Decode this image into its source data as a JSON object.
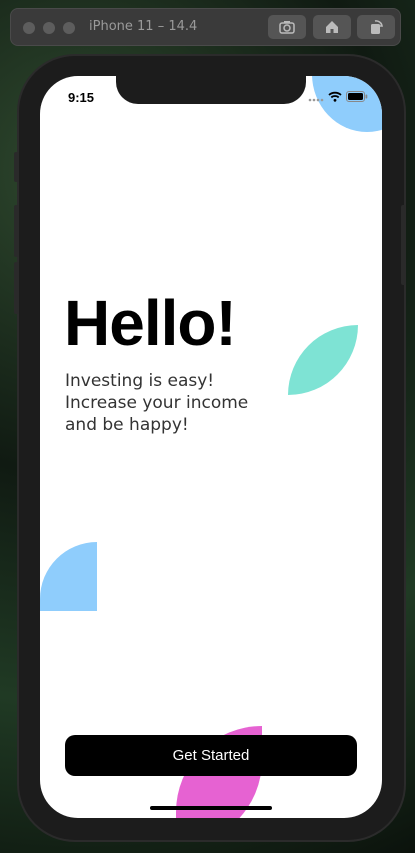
{
  "window": {
    "title": "iPhone 11 – 14.4",
    "buttons": [
      "screenshot-icon",
      "home-icon",
      "rotate-icon"
    ]
  },
  "status_bar": {
    "time": "9:15",
    "icons": [
      "signal-icon",
      "wifi-icon",
      "battery-icon"
    ]
  },
  "content": {
    "heading": "Hello!",
    "tagline_lines": [
      "Investing is easy!",
      "Increase your income",
      "and be happy!"
    ],
    "cta_label": "Get Started"
  },
  "colors": {
    "blue_shape": "#8fcdfc",
    "teal_shape": "#7ee3d4",
    "pink_shape": "#e662d2",
    "button_bg": "#000000"
  }
}
